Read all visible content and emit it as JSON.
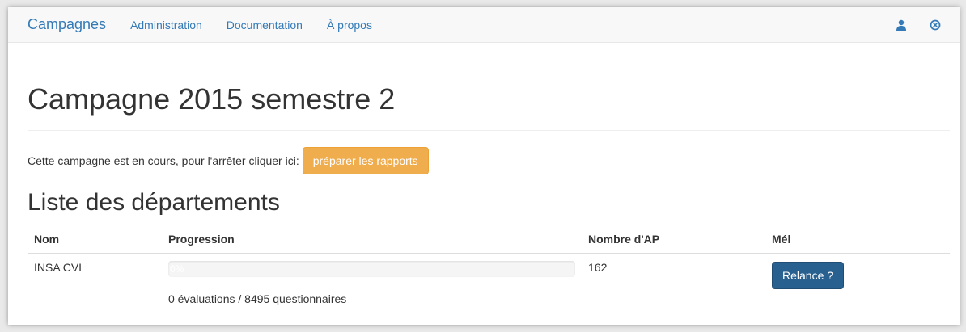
{
  "navbar": {
    "brand": "Campagnes",
    "links": [
      "Administration",
      "Documentation",
      "À propos"
    ],
    "icons": [
      "user-icon",
      "logout-icon"
    ]
  },
  "page": {
    "title": "Campagne 2015 semestre 2",
    "status_text": "Cette campagne est en cours, pour l'arrêter cliquer ici:",
    "stop_button": "préparer les rapports",
    "section_title": "Liste des départements"
  },
  "table": {
    "headers": [
      "Nom",
      "Progression",
      "Nombre d'AP",
      "Mél"
    ],
    "rows": [
      {
        "name": "INSA CVL",
        "progress_percent": 0,
        "progress_label": "0%",
        "progress_caption": "0 évaluations / 8495 questionnaires",
        "ap_count": "162",
        "mail_button": "Relance ?"
      }
    ]
  },
  "colors": {
    "primary": "#337ab7",
    "warning": "#f0ad4e",
    "button_dark": "#286090"
  }
}
